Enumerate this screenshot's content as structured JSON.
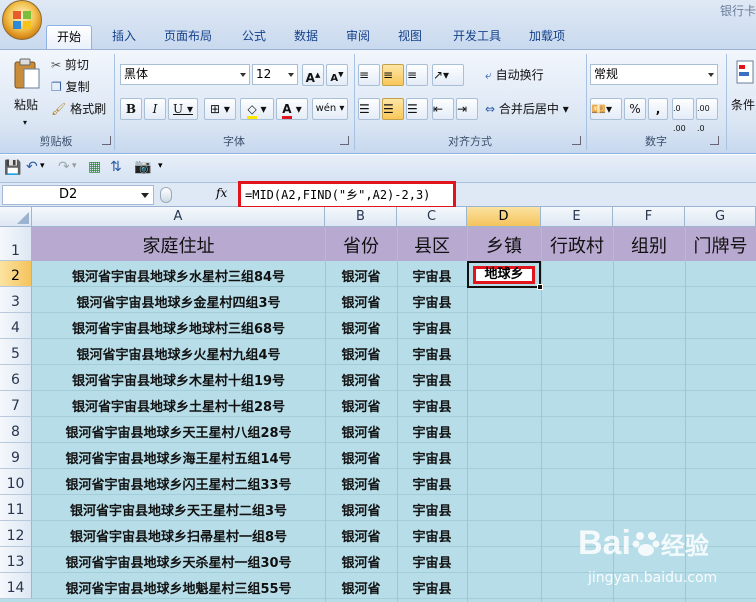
{
  "window_title": "银行卡",
  "tabs": [
    "开始",
    "插入",
    "页面布局",
    "公式",
    "数据",
    "审阅",
    "视图",
    "开发工具",
    "加载项"
  ],
  "ribbon": {
    "clipboard": {
      "paste": "粘贴",
      "cut": "剪切",
      "copy": "复制",
      "format_painter": "格式刷",
      "group": "剪贴板"
    },
    "font": {
      "name": "黑体",
      "size": "12",
      "group": "字体"
    },
    "alignment": {
      "wrap": "自动换行",
      "merge": "合并后居中",
      "group": "对齐方式"
    },
    "number": {
      "format": "常规",
      "percent": "%",
      "comma": ",",
      "group": "数字"
    },
    "styles": {
      "conditional": "条件"
    }
  },
  "formula_bar": {
    "name_box": "D2",
    "fx": "fx",
    "formula": "=MID(A2,FIND(\"乡\",A2)-2,3)"
  },
  "columns": [
    "A",
    "B",
    "C",
    "D",
    "E",
    "F",
    "G"
  ],
  "header_row": [
    "家庭住址",
    "省份",
    "县区",
    "乡镇",
    "行政村",
    "组别",
    "门牌号"
  ],
  "rows": [
    {
      "n": "2",
      "a": "银河省宇宙县地球乡水星村三组84号",
      "b": "银河省",
      "c": "宇宙县",
      "d": "地球乡"
    },
    {
      "n": "3",
      "a": "银河省宇宙县地球乡金星村四组3号",
      "b": "银河省",
      "c": "宇宙县",
      "d": ""
    },
    {
      "n": "4",
      "a": "银河省宇宙县地球乡地球村三组68号",
      "b": "银河省",
      "c": "宇宙县",
      "d": ""
    },
    {
      "n": "5",
      "a": "银河省宇宙县地球乡火星村九组4号",
      "b": "银河省",
      "c": "宇宙县",
      "d": ""
    },
    {
      "n": "6",
      "a": "银河省宇宙县地球乡木星村十组19号",
      "b": "银河省",
      "c": "宇宙县",
      "d": ""
    },
    {
      "n": "7",
      "a": "银河省宇宙县地球乡土星村十组28号",
      "b": "银河省",
      "c": "宇宙县",
      "d": ""
    },
    {
      "n": "8",
      "a": "银河省宇宙县地球乡天王星村八组28号",
      "b": "银河省",
      "c": "宇宙县",
      "d": ""
    },
    {
      "n": "9",
      "a": "银河省宇宙县地球乡海王星村五组14号",
      "b": "银河省",
      "c": "宇宙县",
      "d": ""
    },
    {
      "n": "10",
      "a": "银河省宇宙县地球乡闪王星村二组33号",
      "b": "银河省",
      "c": "宇宙县",
      "d": ""
    },
    {
      "n": "11",
      "a": "银河省宇宙县地球乡天王星村二组3号",
      "b": "银河省",
      "c": "宇宙县",
      "d": ""
    },
    {
      "n": "12",
      "a": "银河省宇宙县地球乡扫帚星村一组8号",
      "b": "银河省",
      "c": "宇宙县",
      "d": ""
    },
    {
      "n": "13",
      "a": "银河省宇宙县地球乡天杀星村一组30号",
      "b": "银河省",
      "c": "宇宙县",
      "d": ""
    },
    {
      "n": "14",
      "a": "银河省宇宙县地球乡地魁星村三组55号",
      "b": "银河省",
      "c": "宇宙县",
      "d": ""
    }
  ],
  "watermark": {
    "brand": "Bai",
    "brand2": "经验",
    "url": "jingyan.baidu.com"
  },
  "colors": {
    "header_fill": "#b8a9d0",
    "data_fill": "#b7dde8",
    "highlight": "#e0141a"
  }
}
